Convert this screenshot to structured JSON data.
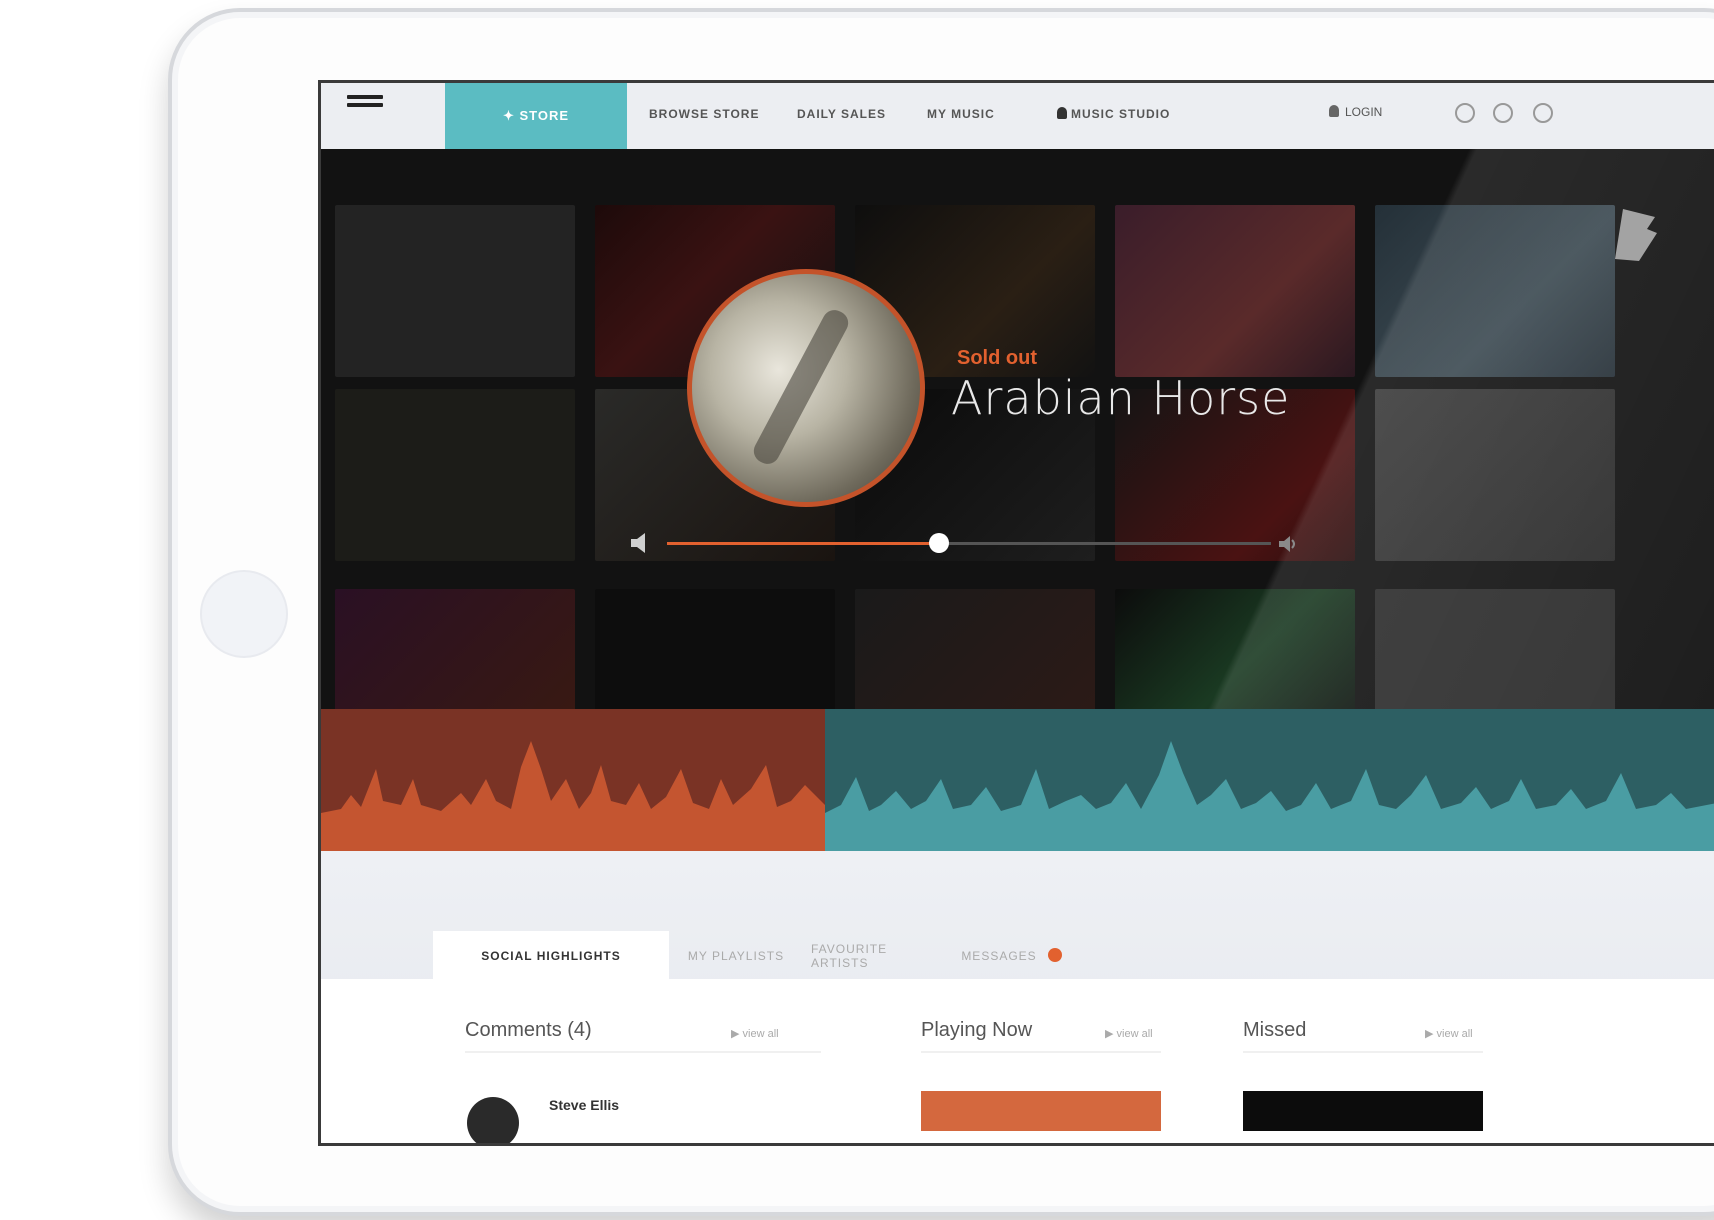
{
  "nav": {
    "active_label": "✦ STORE",
    "items": [
      "BROWSE STORE",
      "DAILY SALES",
      "MY MUSIC",
      "MUSIC STUDIO"
    ],
    "login_label": "LOGIN"
  },
  "hero": {
    "now_label": "Sold out",
    "track_title": "Arabian Horse",
    "progress": 0.45
  },
  "tabs": [
    {
      "label": "SOCIAL HIGHLIGHTS",
      "active": true
    },
    {
      "label": "MY PLAYLISTS",
      "active": false
    },
    {
      "label": "FAVOURITE ARTISTS",
      "active": false
    },
    {
      "label": "MESSAGES",
      "active": false
    }
  ],
  "columns": {
    "comments": {
      "title": "Comments (4)",
      "link": "▶ view all"
    },
    "playing": {
      "title": "Playing Now",
      "link": "▶ view all"
    },
    "missed": {
      "title": "Missed",
      "link": "▶ view all"
    }
  },
  "comment": {
    "name": "Steve Ellis"
  },
  "colors": {
    "accent_teal": "#5bbcc2",
    "accent_orange": "#e2612f",
    "wave_left": "#7a3325",
    "wave_right": "#2d5f63"
  }
}
